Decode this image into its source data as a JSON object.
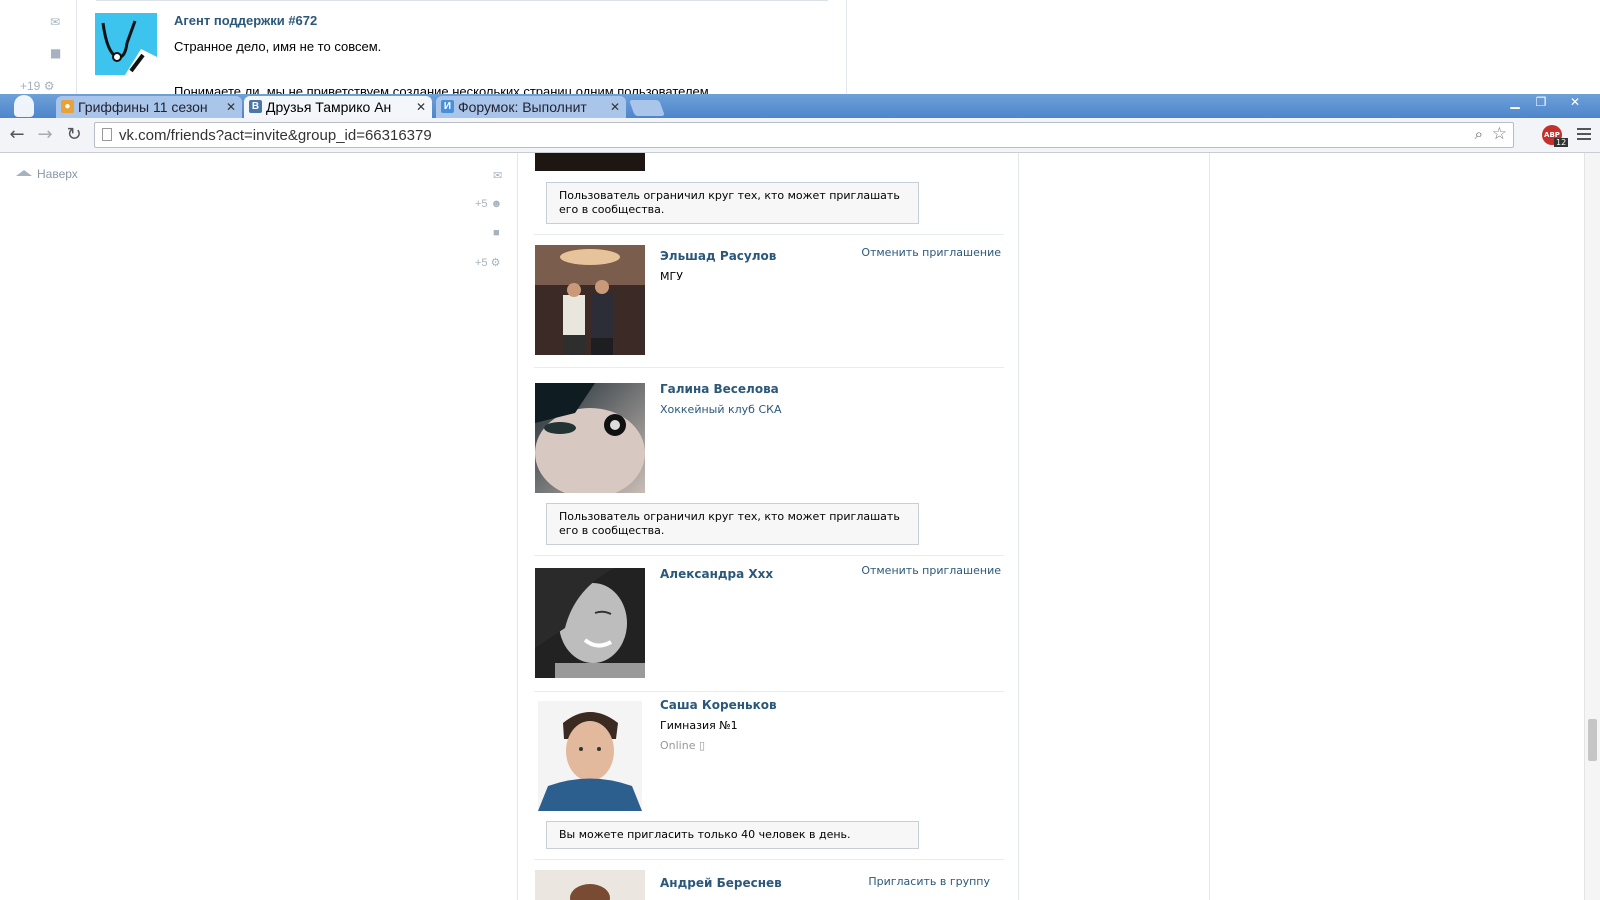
{
  "background_window": {
    "sender_name": "Агент поддержки #672",
    "message_line1": "Странное дело, имя не то совсем.",
    "message_line2": "Понимаете ли, мы не приветствуем создание нескольких страниц одним пользователем.",
    "counter": "+19",
    "icons": [
      "mail-icon",
      "comment-icon",
      "gear-icon"
    ]
  },
  "tabs": [
    {
      "title": "Гриффины 11 сезон",
      "favicon": "kinopoisk-favicon",
      "active": false
    },
    {
      "title": "Друзья Тамрико Ан",
      "favicon": "vk-favicon",
      "active": true
    },
    {
      "title": "Форумок: Выполнит",
      "favicon": "forum-favicon",
      "active": false
    }
  ],
  "toolbar": {
    "url": "vk.com/friends?act=invite&group_id=66316379",
    "extension_badge": "12",
    "extension_name": "ABP"
  },
  "sidebar": {
    "up_link": "Наверх",
    "counters": [
      "+5",
      "+5"
    ]
  },
  "friends": [
    {
      "name": "Эльшад Расулов",
      "info": "МГУ",
      "info_style": "plain",
      "action": "Отменить приглашение",
      "notice": ""
    },
    {
      "name": "Галина Веселова",
      "info": "Хоккейный клуб СКА",
      "info_style": "link",
      "action": "",
      "notice": "Пользователь ограничил круг тех, кто может приглашать его в сообщества."
    },
    {
      "name": "Александра Ххх",
      "info": "",
      "info_style": "plain",
      "action": "Отменить приглашение",
      "notice": ""
    },
    {
      "name": "Саша Кореньков",
      "info": "Гимназия №1",
      "status": "Online",
      "info_style": "plain",
      "action": "",
      "notice": "Вы можете пригласить только 40 человек в день."
    },
    {
      "name": "Андрей Береснев",
      "info": "",
      "info_style": "plain",
      "action": "Пригласить в группу",
      "notice": ""
    }
  ],
  "top_notice": "Пользователь ограничил круг тех, кто может приглашать его в сообщества.",
  "colors": {
    "vk_link": "#2b587a",
    "chrome_tabbar": "#5a8fd2",
    "notice_border": "#c8ced6"
  }
}
